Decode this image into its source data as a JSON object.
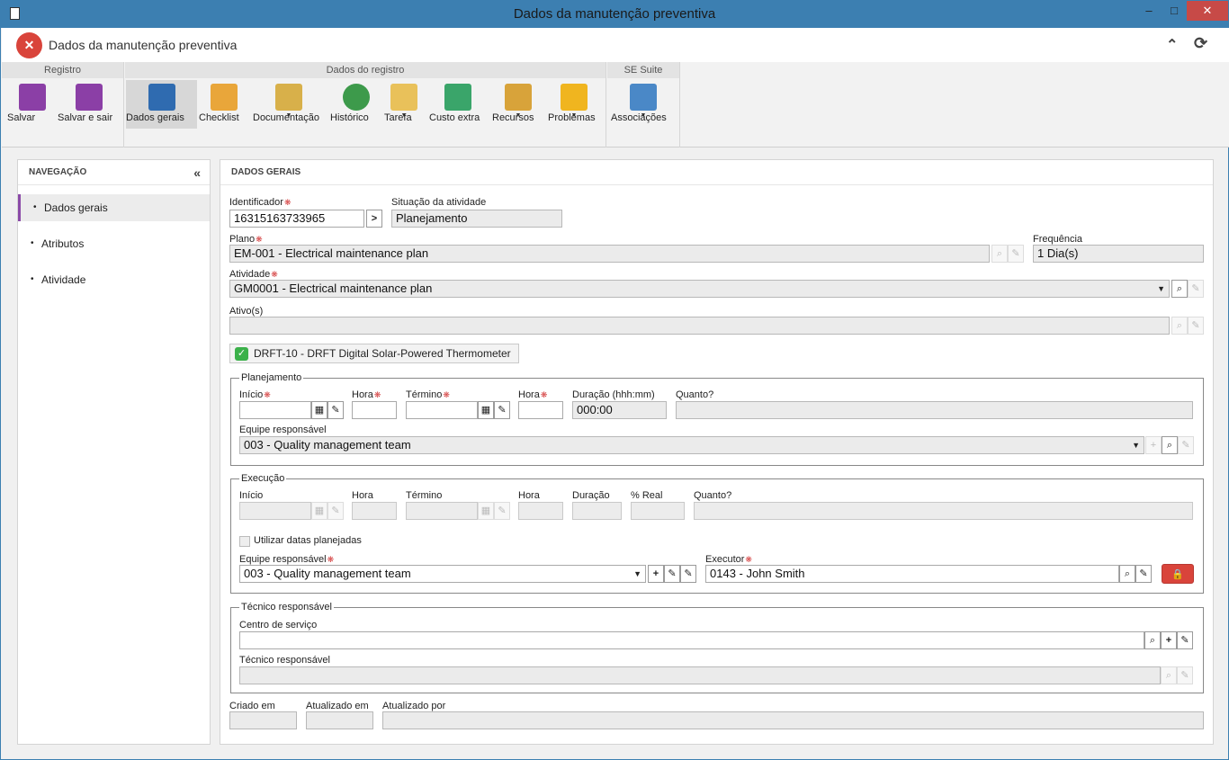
{
  "window": {
    "title": "Dados da manutenção preventiva",
    "min": "–",
    "max": "□",
    "close": "✕"
  },
  "app": {
    "title": "Dados da manutenção preventiva",
    "logo": "✕",
    "collapse_icon": "⌃",
    "refresh_icon": "⟳"
  },
  "ribbon": {
    "groups": {
      "registro": "Registro",
      "dados": "Dados do registro",
      "se": "SE Suite"
    },
    "buttons": {
      "salvar": "Salvar",
      "salvar_sair": "Salvar e sair",
      "dados_gerais": "Dados gerais",
      "checklist": "Checklist",
      "documentacao": "Documentação",
      "historico": "Histórico",
      "tarefa": "Tarefa",
      "custo_extra": "Custo extra",
      "recursos": "Recursos",
      "problemas": "Problemas",
      "associacoes": "Associações"
    },
    "caret": "▼"
  },
  "nav": {
    "header": "NAVEGAÇÃO",
    "collapse": "«",
    "items": [
      "Dados gerais",
      "Atributos",
      "Atividade"
    ]
  },
  "main": {
    "header": "DADOS GERAIS"
  },
  "form": {
    "identificador_label": "Identificador",
    "identificador": "16315163733965",
    "situacao_label": "Situação da atividade",
    "situacao": "Planejamento",
    "plano_label": "Plano",
    "plano": "EM-001 - Electrical maintenance plan",
    "frequencia_label": "Frequência",
    "frequencia": "1 Dia(s)",
    "atividade_label": "Atividade",
    "atividade": "GM0001 - Electrical maintenance plan",
    "ativos_label": "Ativo(s)",
    "ativos": "",
    "asset_chip": "DRFT-10 - DRFT Digital Solar-Powered Thermometer",
    "planejamento": {
      "legend": "Planejamento",
      "inicio": "Início",
      "hora": "Hora",
      "termino": "Término",
      "hora2": "Hora",
      "duracao_label": "Duração (hhh:mm)",
      "duracao": "000:00",
      "quanto": "Quanto?",
      "equipe_label": "Equipe responsável",
      "equipe": "003 - Quality management team"
    },
    "execucao": {
      "legend": "Execução",
      "inicio": "Início",
      "hora": "Hora",
      "termino": "Término",
      "hora2": "Hora",
      "duracao": "Duração",
      "real": "% Real",
      "quanto": "Quanto?",
      "usar_datas": "Utilizar datas planejadas",
      "equipe_label": "Equipe responsável",
      "equipe": "003 - Quality management team",
      "executor_label": "Executor",
      "executor": "0143 - John Smith"
    },
    "tecnico": {
      "legend": "Técnico responsável",
      "centro_label": "Centro de serviço",
      "tecnico_label": "Técnico responsável"
    },
    "criado_label": "Criado em",
    "atualizado_label": "Atualizado em",
    "atualizado_por_label": "Atualizado por"
  }
}
